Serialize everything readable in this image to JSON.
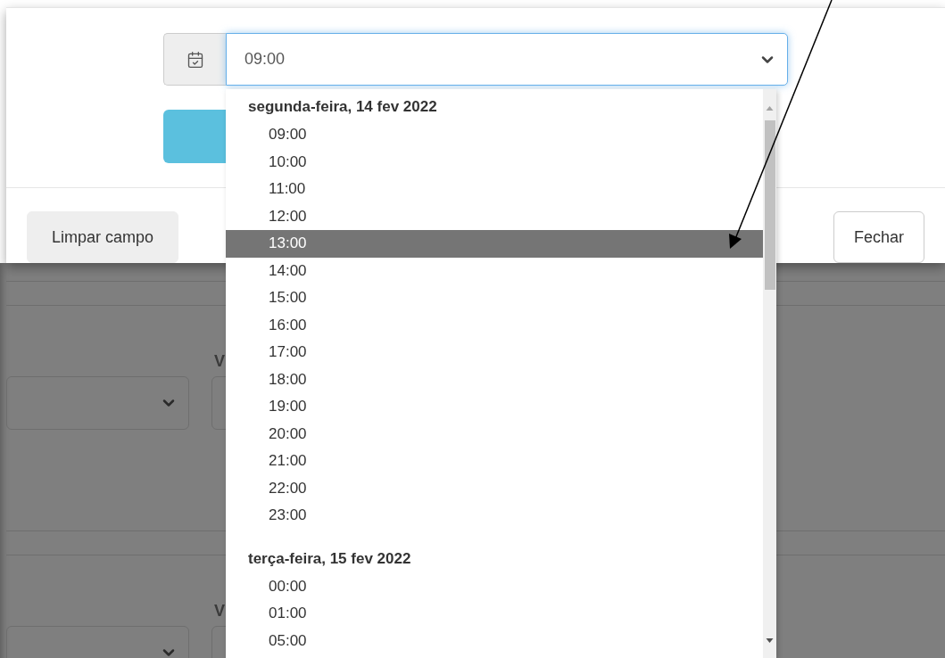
{
  "time_field": {
    "value": "09:00"
  },
  "dropdown": {
    "groups": [
      {
        "label": "segunda-feira, 14 fev 2022",
        "options": [
          {
            "label": "09:00",
            "selected": false
          },
          {
            "label": "10:00",
            "selected": false
          },
          {
            "label": "11:00",
            "selected": false
          },
          {
            "label": "12:00",
            "selected": false
          },
          {
            "label": "13:00",
            "selected": true
          },
          {
            "label": "14:00",
            "selected": false
          },
          {
            "label": "15:00",
            "selected": false
          },
          {
            "label": "16:00",
            "selected": false
          },
          {
            "label": "17:00",
            "selected": false
          },
          {
            "label": "18:00",
            "selected": false
          },
          {
            "label": "19:00",
            "selected": false
          },
          {
            "label": "20:00",
            "selected": false
          },
          {
            "label": "21:00",
            "selected": false
          },
          {
            "label": "22:00",
            "selected": false
          },
          {
            "label": "23:00",
            "selected": false
          }
        ]
      },
      {
        "label": "terça-feira, 15 fev 2022",
        "options": [
          {
            "label": "00:00",
            "selected": false
          },
          {
            "label": "01:00",
            "selected": false
          },
          {
            "label": "05:00",
            "selected": false
          }
        ]
      }
    ]
  },
  "footer": {
    "buttons": [
      {
        "label": "Limpar campo",
        "kind": "secondary"
      },
      {
        "label": "Fechar",
        "kind": "default"
      }
    ]
  },
  "background_form": {
    "labels": [
      "V",
      "V"
    ]
  }
}
